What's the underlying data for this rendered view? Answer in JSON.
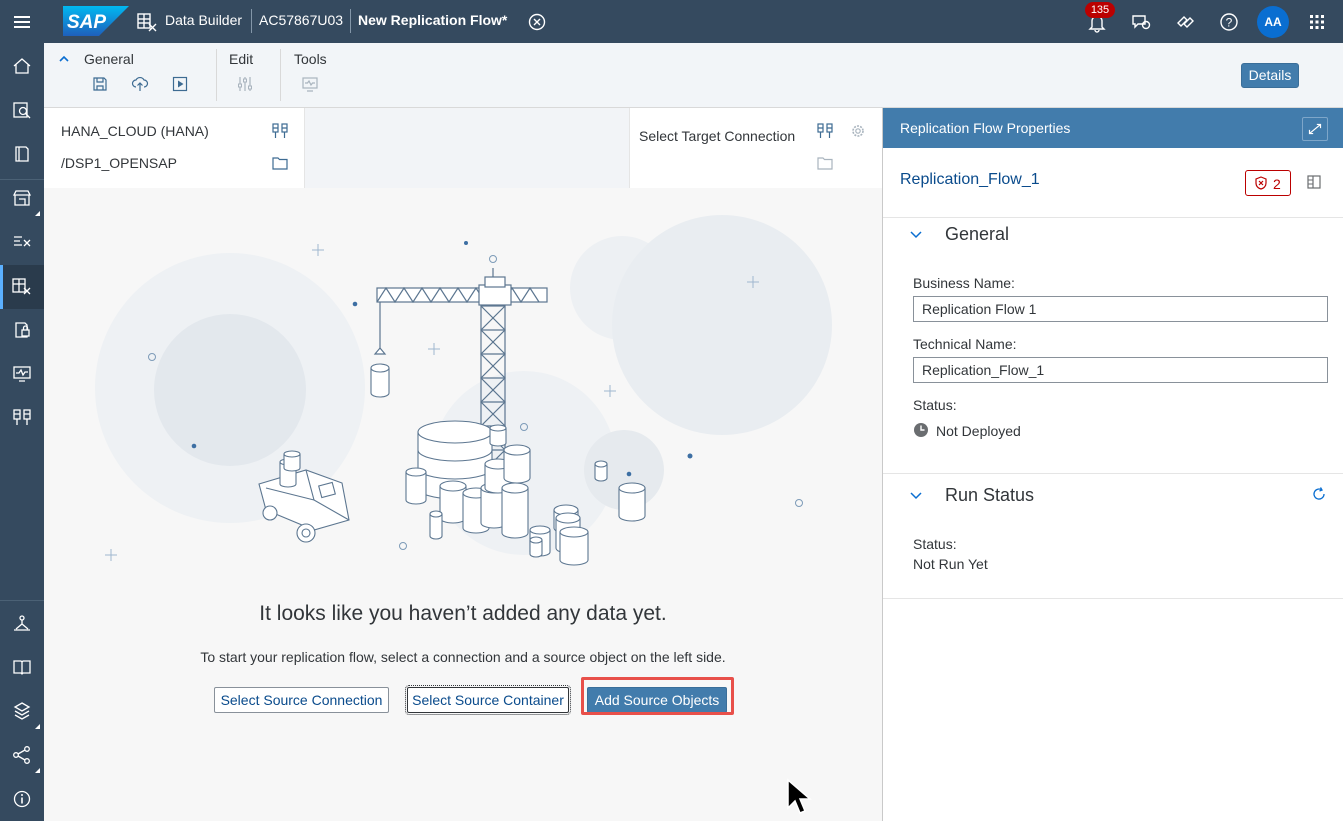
{
  "shell": {
    "logo_text": "SAP",
    "app_name": "Data Builder",
    "space_id": "AC57867U03",
    "doc_title": "New Replication Flow*",
    "notification_count": "135",
    "avatar_initials": "AA",
    "icons": [
      "menu-icon",
      "data-builder-icon",
      "close-circle-icon",
      "bell-icon",
      "feedback-icon",
      "help-chat-icon",
      "help-icon",
      "app-grid-icon"
    ]
  },
  "leftnav": {
    "items": [
      "home",
      "data-marketplace",
      "repository-explorer",
      "data-access",
      "business-builder",
      "data-builder",
      "security",
      "data-integration-monitor",
      "connections",
      "system-monitor",
      "catalog",
      "space-management",
      "transport",
      "about"
    ]
  },
  "toolbar": {
    "groups": [
      {
        "label": "General",
        "icons": [
          "save-icon",
          "deploy-icon",
          "run-icon"
        ]
      },
      {
        "label": "Edit",
        "icons": [
          "settings-sliders-icon"
        ]
      },
      {
        "label": "Tools",
        "icons": [
          "monitor-icon"
        ]
      }
    ],
    "details_label": "Details"
  },
  "connection": {
    "source_connection": "HANA_CLOUD (HANA)",
    "source_container": "/DSP1_OPENSAP",
    "target_placeholder": "Select Target Connection"
  },
  "canvas": {
    "empty_title": "It looks like you haven’t added any data yet.",
    "empty_subtitle": "To start your replication flow, select a connection and a source object on the left side.",
    "buttons": {
      "select_source_connection": "Select Source Connection",
      "select_source_container": "Select Source Container",
      "add_source_objects": "Add Source Objects"
    }
  },
  "properties": {
    "panel_title": "Replication Flow Properties",
    "object_name": "Replication_Flow_1",
    "error_count": "2",
    "general": {
      "title": "General",
      "business_name_label": "Business Name:",
      "business_name_value": "Replication Flow 1",
      "technical_name_label": "Technical Name:",
      "technical_name_value": "Replication_Flow_1",
      "status_label": "Status:",
      "status_value": "Not Deployed"
    },
    "run_status": {
      "title": "Run Status",
      "status_label": "Status:",
      "status_value": "Not Run Yet"
    }
  },
  "colors": {
    "shell": "#354a5f",
    "accent": "#427cac",
    "highlight": "#e8504a",
    "error": "#bb0000"
  }
}
